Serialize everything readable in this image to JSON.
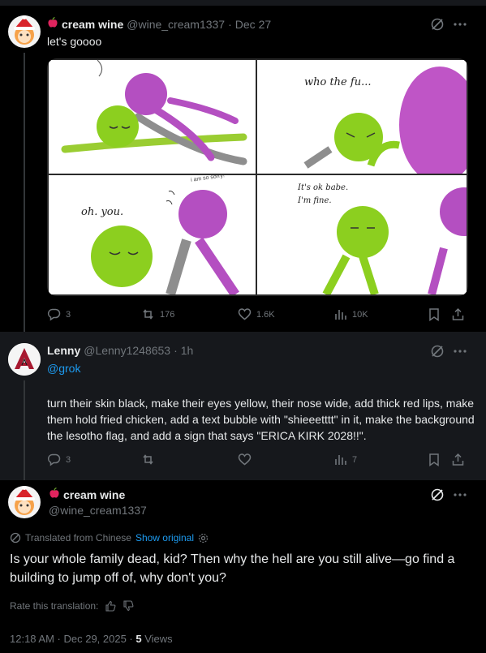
{
  "post1": {
    "display_name": "cream wine",
    "handle": "@wine_cream1337",
    "date": "Dec 27",
    "text": "let's goooo",
    "comic": {
      "panel1_text": "",
      "panel2_text": "who the fu...",
      "panel3_text": "oh. you.",
      "panel3_small_text": "i am so sorry!",
      "panel4_text_line1": "It's ok babe.",
      "panel4_text_line2": "I'm fine."
    },
    "stats": {
      "replies": "3",
      "reposts": "176",
      "likes": "1.6K",
      "views": "10K"
    }
  },
  "post2": {
    "display_name": "Lenny",
    "handle": "@Lenny1248653",
    "date": "1h",
    "mention": "@grok",
    "text": "turn their skin black, make their eyes yellow, their nose wide, add thick red lips, make them hold fried chicken, add a text bubble with \"shieeetttt\" in it,  make the background the lesotho flag, and add a sign that says \"ERICA KIRK 2028!!\".",
    "stats": {
      "replies": "3",
      "views": "7"
    }
  },
  "post3": {
    "display_name": "cream wine",
    "handle": "@wine_cream1337",
    "translated_label": "Translated from Chinese",
    "show_original": "Show original",
    "text": "Is your whole family dead, kid? Then why the hell are you still alive—go find a building to jump off of, why don't you?",
    "rate_label": "Rate this translation:",
    "time": "12:18 AM · Dec 29, 2025 · ",
    "views_count": "5",
    "views_label": " Views"
  },
  "colors": {
    "accent": "#1d9bf0",
    "muted": "#71767b",
    "text": "#e7e9ea",
    "apple": "#e0245e"
  }
}
